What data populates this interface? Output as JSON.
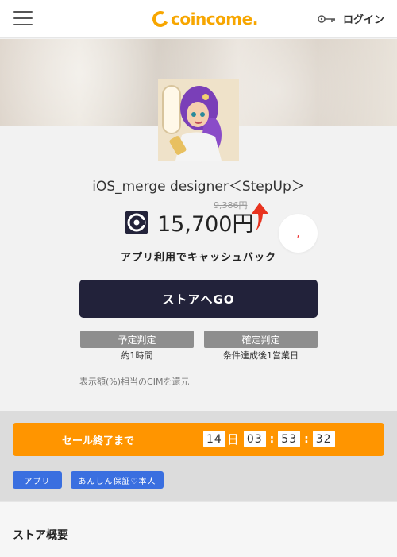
{
  "header": {
    "logo_text": "coincome.",
    "login_label": "ログイン"
  },
  "app": {
    "title": "iOS_merge designer＜StepUp＞",
    "old_price": "9,386円",
    "price": "15,700円",
    "fav_symbol": ",",
    "caption": "アプリ利用でキャッシュバック",
    "go_label": "ストアへGO",
    "judge_left_label": "予定判定",
    "judge_left_value": "約1時間",
    "judge_right_label": "確定判定",
    "judge_right_value": "条件達成後1営業日",
    "note": "表示額(%)相当のCIMを還元"
  },
  "sale": {
    "label": "セール終了まで",
    "days": "14",
    "day_unit": "日",
    "hours": "03",
    "minutes": "53",
    "seconds": "32",
    "separator": ":"
  },
  "tags": [
    "アプリ",
    "あんしん保証♡本人"
  ],
  "store": {
    "title": "ストア概要"
  },
  "colors": {
    "brand": "#f7a600",
    "primary_button": "#22223a",
    "sale_bar": "#ff9500",
    "tag": "#3a6fe0",
    "arrow": "#e8331f"
  }
}
